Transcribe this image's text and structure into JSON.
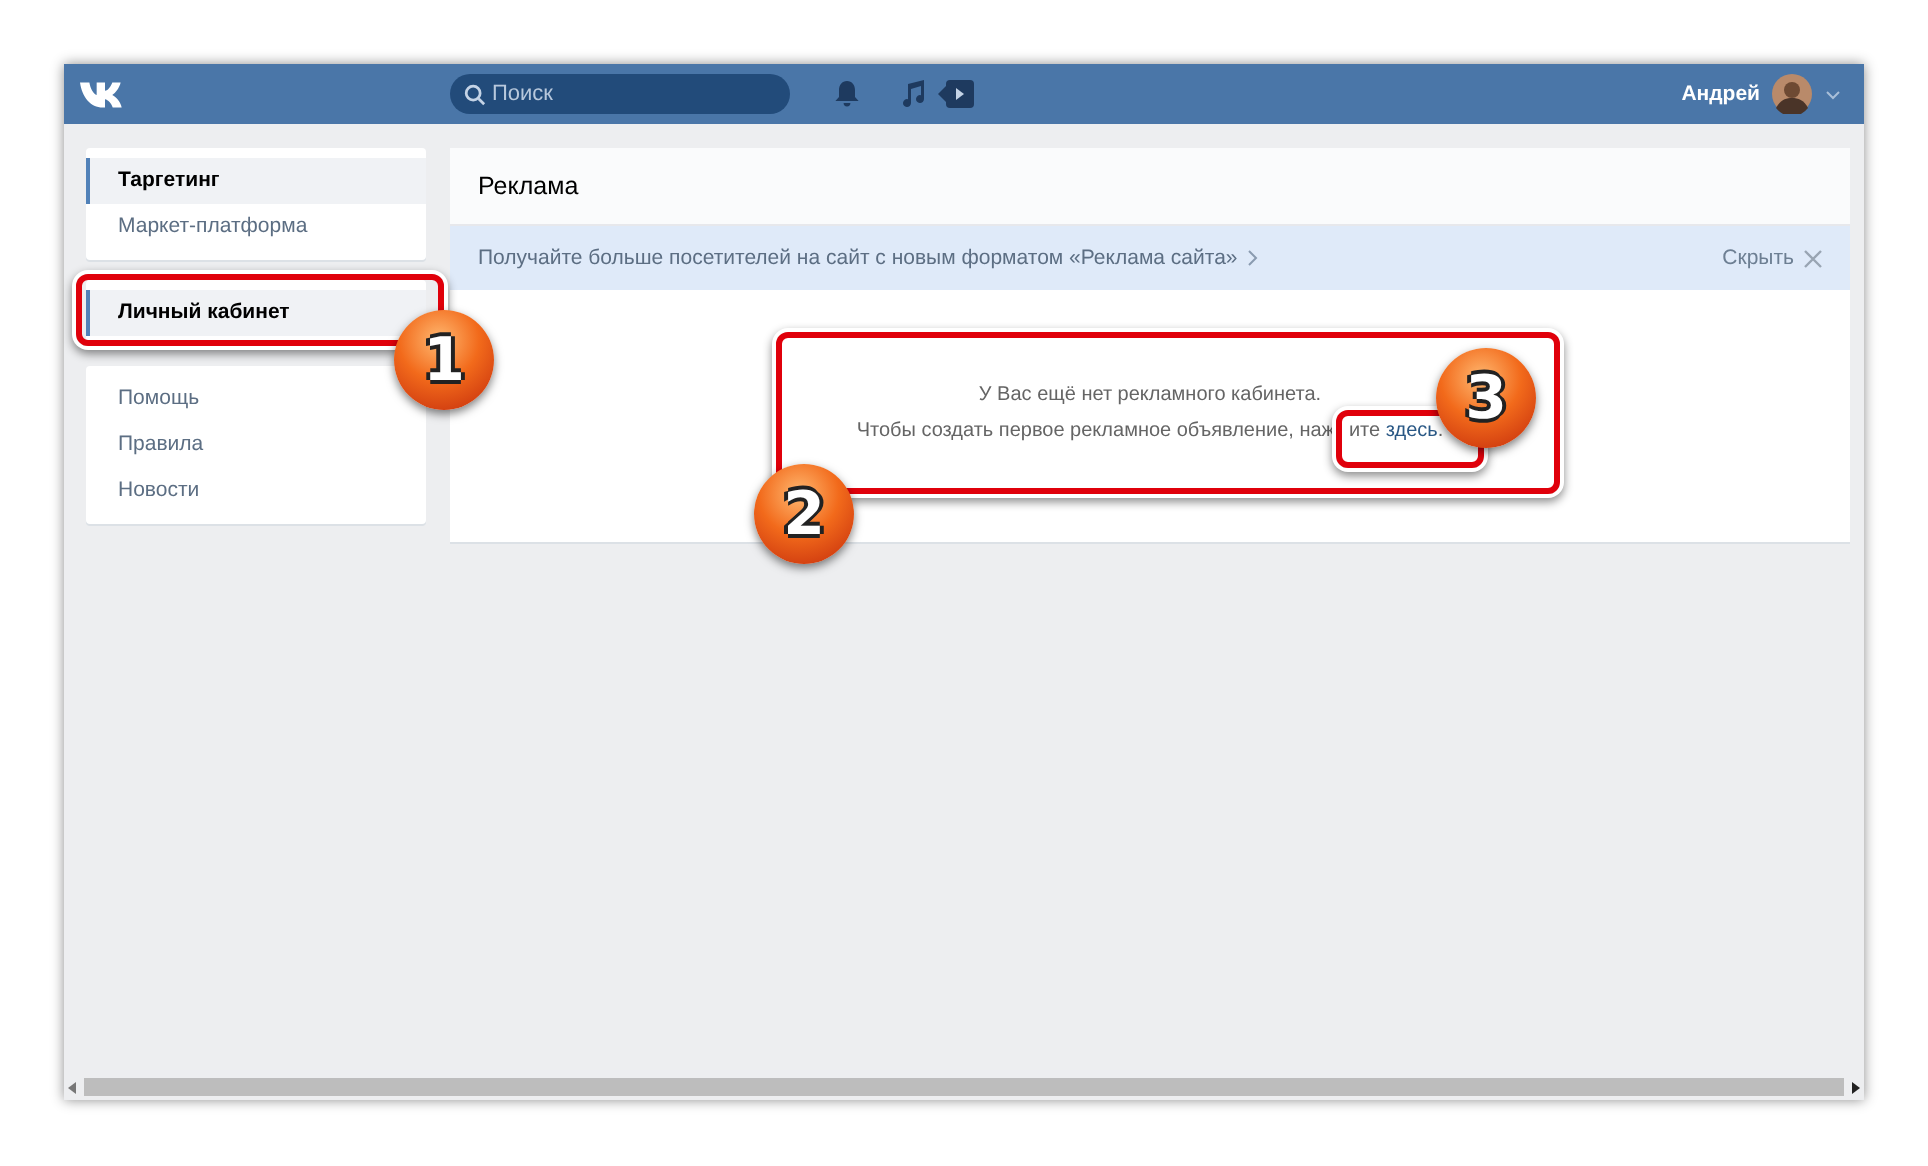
{
  "header": {
    "search": {
      "placeholder": "Поиск"
    },
    "user": {
      "name": "Андрей"
    }
  },
  "sidebar": {
    "groups": [
      {
        "items": [
          {
            "label": "Таргетинг",
            "selected": true
          },
          {
            "label": "Маркет-платформа",
            "selected": false
          }
        ]
      },
      {
        "items": [
          {
            "label": "Личный кабинет",
            "selected": true
          }
        ]
      },
      {
        "items": [
          {
            "label": "Помощь",
            "selected": false
          },
          {
            "label": "Правила",
            "selected": false
          },
          {
            "label": "Новости",
            "selected": false
          }
        ]
      }
    ]
  },
  "content": {
    "title": "Реклама",
    "banner": {
      "text": "Получайте больше посетителей на сайт с новым форматом «Реклама сайта»",
      "close_label": "Скрыть"
    },
    "empty": {
      "line_1": "У Вас ещё нет рекламного кабинета.",
      "line_2_start": "Чтобы создать первое рекламное объявление, наж",
      "line_2_rest": "ите",
      "link": "здесь",
      "end": "."
    }
  },
  "annotations": [
    {
      "number": "1"
    },
    {
      "number": "2"
    },
    {
      "number": "3"
    }
  ]
}
